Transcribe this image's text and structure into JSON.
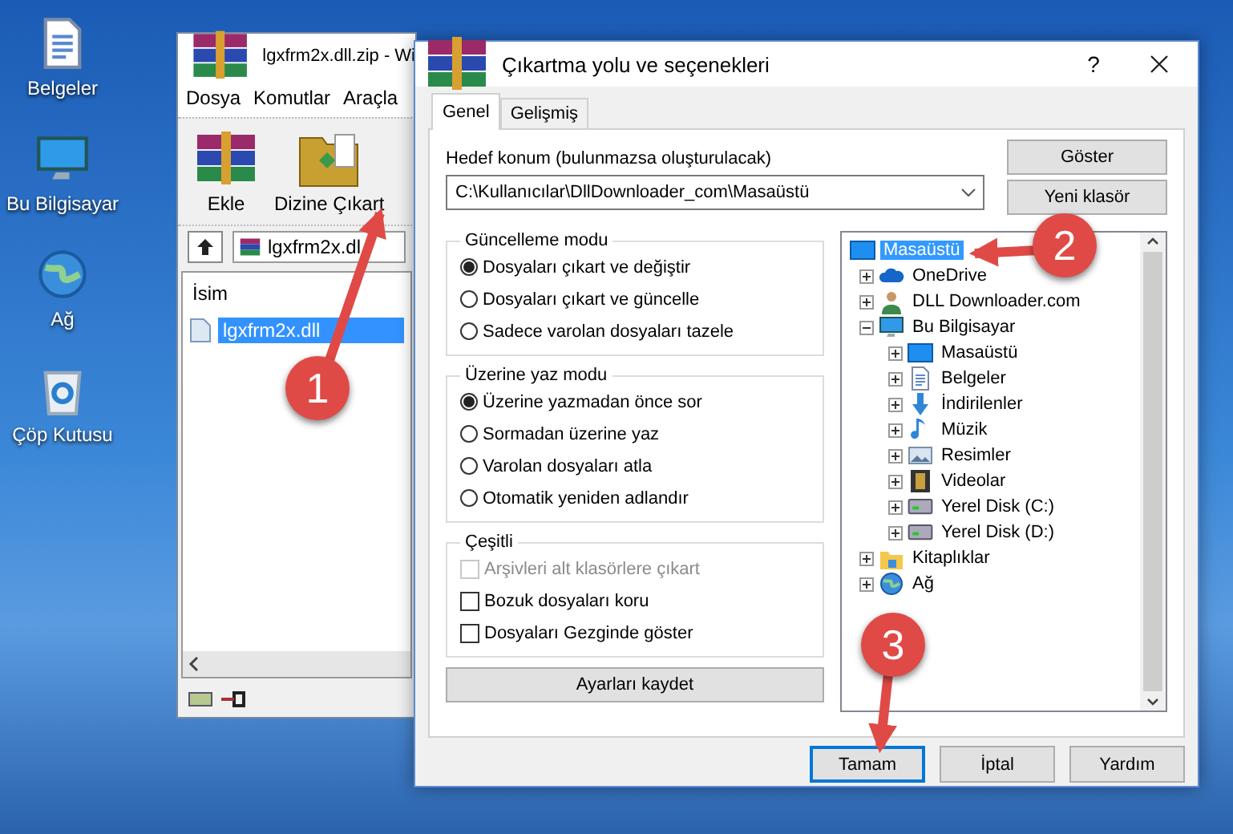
{
  "desktop_icons": [
    {
      "label": "Belgeler",
      "kind": "documents"
    },
    {
      "label": "Bu Bilgisayar",
      "kind": "computer"
    },
    {
      "label": "Ağ",
      "kind": "network"
    },
    {
      "label": "Çöp Kutusu",
      "kind": "trash"
    }
  ],
  "archive_window": {
    "title": "lgxfrm2x.dll.zip - Wi",
    "menu": [
      "Dosya",
      "Komutlar",
      "Araçla"
    ],
    "toolbar": [
      {
        "label": "Ekle",
        "kind": "add"
      },
      {
        "label": "Dizine Çıkart",
        "kind": "extract"
      }
    ],
    "address": "lgxfrm2x.dl",
    "column": "İsim",
    "files": [
      {
        "name": "lgxfrm2x.dll",
        "selected": true
      }
    ]
  },
  "dialog": {
    "title": "Çıkartma yolu ve seçenekleri",
    "help": "?",
    "tabs": [
      {
        "label": "Genel",
        "selected": true
      },
      {
        "label": "Gelişmiş",
        "selected": false
      }
    ],
    "destination": {
      "label": "Hedef konum (bulunmazsa oluşturulacak)",
      "value": "C:\\Kullanıcılar\\DllDownloader_com\\Masaüstü"
    },
    "side_buttons": [
      "Göster",
      "Yeni klasör"
    ],
    "update_mode": {
      "title": "Güncelleme modu",
      "options": [
        {
          "label": "Dosyaları çıkart ve değiştir",
          "selected": true
        },
        {
          "label": "Dosyaları çıkart ve güncelle",
          "selected": false
        },
        {
          "label": "Sadece varolan dosyaları tazele",
          "selected": false
        }
      ]
    },
    "overwrite_mode": {
      "title": "Üzerine yaz modu",
      "options": [
        {
          "label": "Üzerine yazmadan önce sor",
          "selected": true
        },
        {
          "label": "Sormadan üzerine yaz",
          "selected": false
        },
        {
          "label": "Varolan dosyaları atla",
          "selected": false
        },
        {
          "label": "Otomatik yeniden adlandır",
          "selected": false
        }
      ]
    },
    "misc": {
      "title": "Çeşitli",
      "options": [
        {
          "label": "Arşivleri alt klasörlere çıkart",
          "checked": false,
          "disabled": true
        },
        {
          "label": "Bozuk dosyaları koru",
          "checked": false,
          "disabled": false
        },
        {
          "label": "Dosyaları Gezginde göster",
          "checked": false,
          "disabled": false
        }
      ]
    },
    "save_button": "Ayarları kaydet",
    "tree": [
      {
        "label": "Masaüstü",
        "kind": "desktop",
        "selected": true,
        "children": [
          {
            "label": "OneDrive",
            "kind": "cloud",
            "selected": false,
            "expanded": false
          },
          {
            "label": "DLL Downloader.com",
            "kind": "user",
            "selected": false,
            "expanded": false
          },
          {
            "label": "Bu Bilgisayar",
            "kind": "computer",
            "selected": false,
            "expanded": true,
            "children": [
              {
                "label": "Masaüstü",
                "kind": "desktop",
                "selected": false,
                "expanded": false
              },
              {
                "label": "Belgeler",
                "kind": "documents",
                "selected": false,
                "expanded": false
              },
              {
                "label": "İndirilenler",
                "kind": "downloads",
                "selected": false,
                "expanded": false
              },
              {
                "label": "Müzik",
                "kind": "music",
                "selected": false,
                "expanded": false
              },
              {
                "label": "Resimler",
                "kind": "pictures",
                "selected": false,
                "expanded": false
              },
              {
                "label": "Videolar",
                "kind": "videos",
                "selected": false,
                "expanded": false
              },
              {
                "label": "Yerel Disk (C:)",
                "kind": "drive",
                "selected": false,
                "expanded": false
              },
              {
                "label": "Yerel Disk (D:)",
                "kind": "drive",
                "selected": false,
                "expanded": false
              }
            ]
          },
          {
            "label": "Kitaplıklar",
            "kind": "library",
            "selected": false,
            "expanded": false
          },
          {
            "label": "Ağ",
            "kind": "network",
            "selected": false,
            "expanded": false
          }
        ]
      }
    ],
    "footer_buttons": [
      {
        "label": "Tamam",
        "default": true
      },
      {
        "label": "İptal",
        "default": false
      },
      {
        "label": "Yardım",
        "default": false
      }
    ]
  },
  "annotations": [
    "1",
    "2",
    "3"
  ]
}
